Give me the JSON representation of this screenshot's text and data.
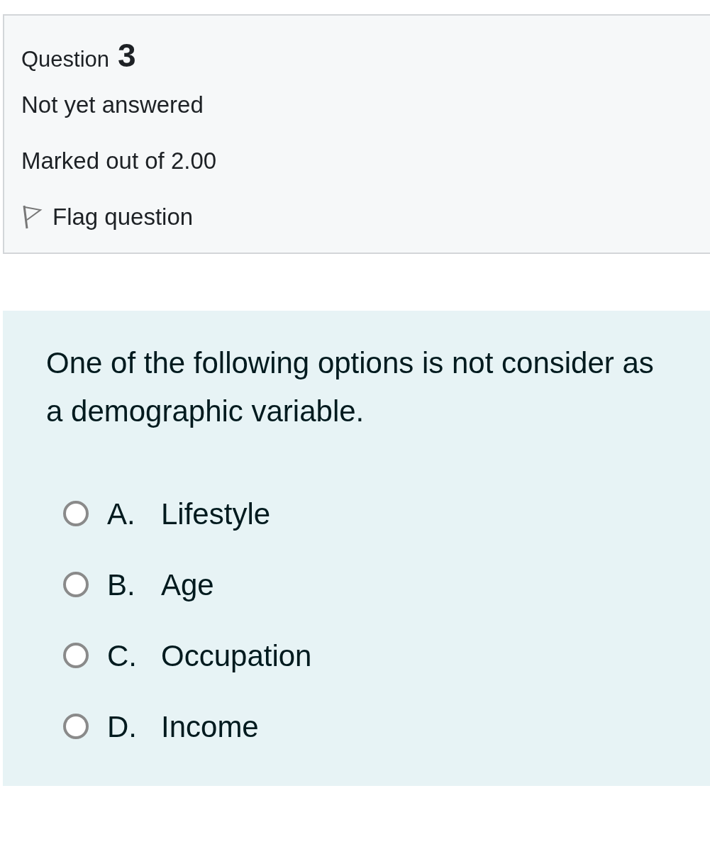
{
  "info": {
    "label": "Question",
    "number": "3",
    "state": "Not yet answered",
    "grade": "Marked out of 2.00",
    "flag": {
      "label": "Flag question",
      "flagged": false
    }
  },
  "question": {
    "text": "One of the following options is not consider as a demographic variable.",
    "options": [
      {
        "letter": "A.",
        "text": "Lifestyle",
        "selected": false
      },
      {
        "letter": "B.",
        "text": "Age",
        "selected": false
      },
      {
        "letter": "C.",
        "text": "Occupation",
        "selected": false
      },
      {
        "letter": "D.",
        "text": "Income",
        "selected": false
      }
    ]
  }
}
